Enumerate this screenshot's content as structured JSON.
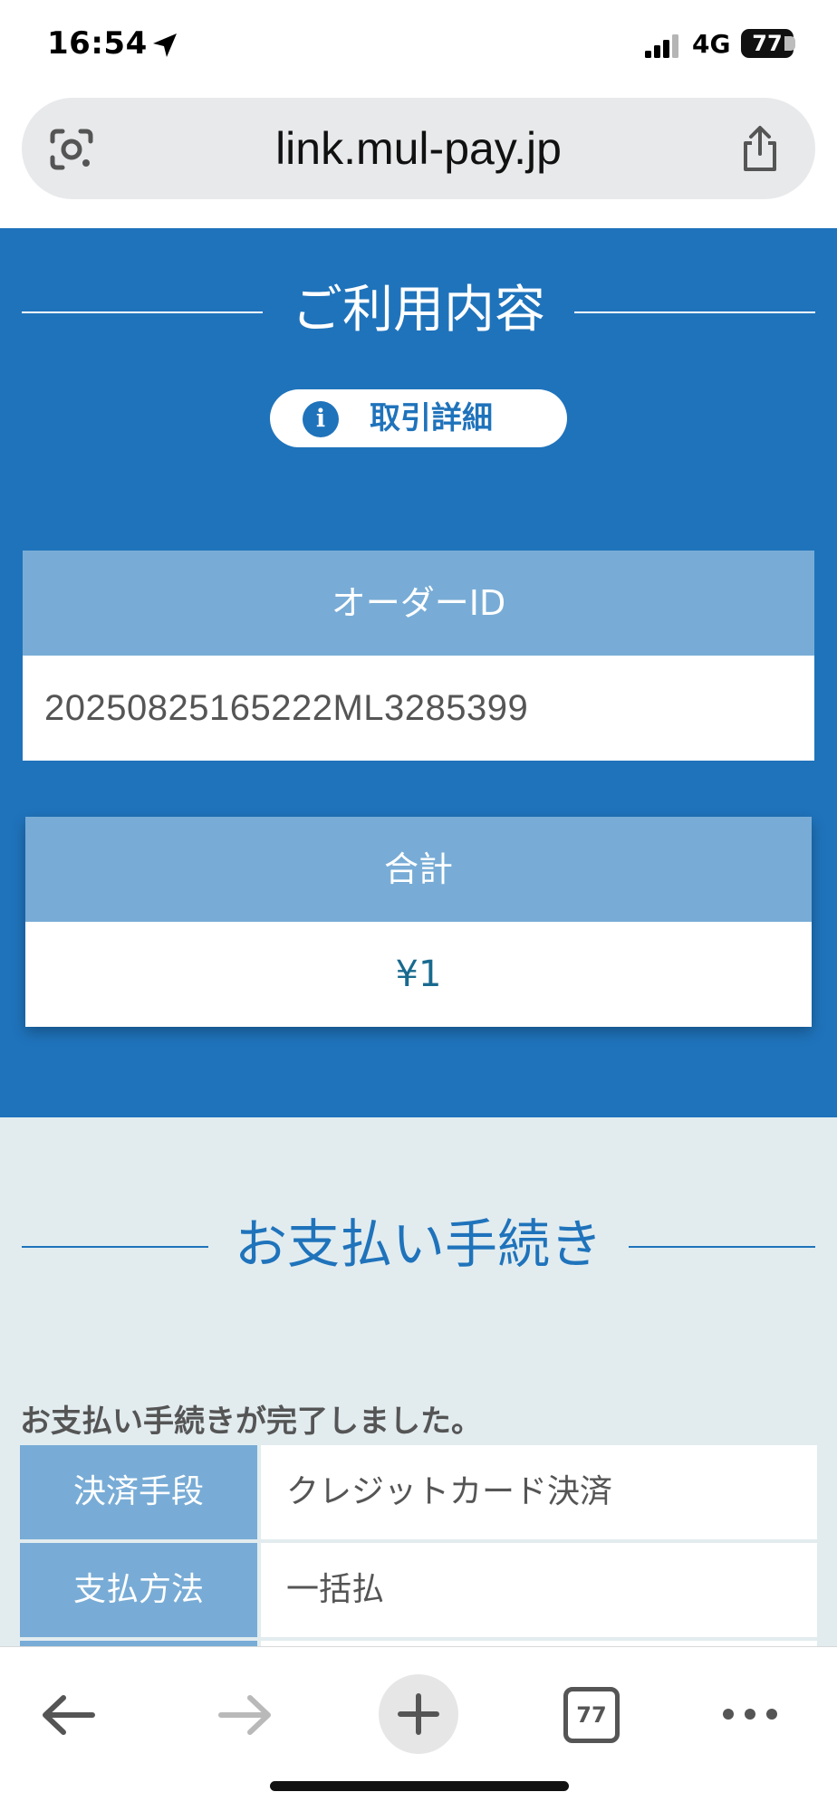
{
  "status_bar": {
    "time": "16:54",
    "network": "4G",
    "battery": "77"
  },
  "browser": {
    "url": "link.mul-pay.jp",
    "tab_count": "77"
  },
  "usage": {
    "title": "ご利用内容",
    "detail_button": "取引詳細",
    "order_id_label": "オーダーID",
    "order_id_value": "20250825165222ML3285399",
    "total_label": "合計",
    "total_value": "¥1"
  },
  "payment": {
    "title": "お支払い手続き",
    "complete_message": "お支払い手続きが完了しました。",
    "rows": [
      {
        "label": "決済手段",
        "value": "クレジットカード決済"
      },
      {
        "label": "支払方法",
        "value": "一括払"
      }
    ]
  },
  "colors": {
    "primary_blue": "#1f73bb",
    "header_blue": "#78acd6",
    "section_bg": "#e2ecef"
  }
}
